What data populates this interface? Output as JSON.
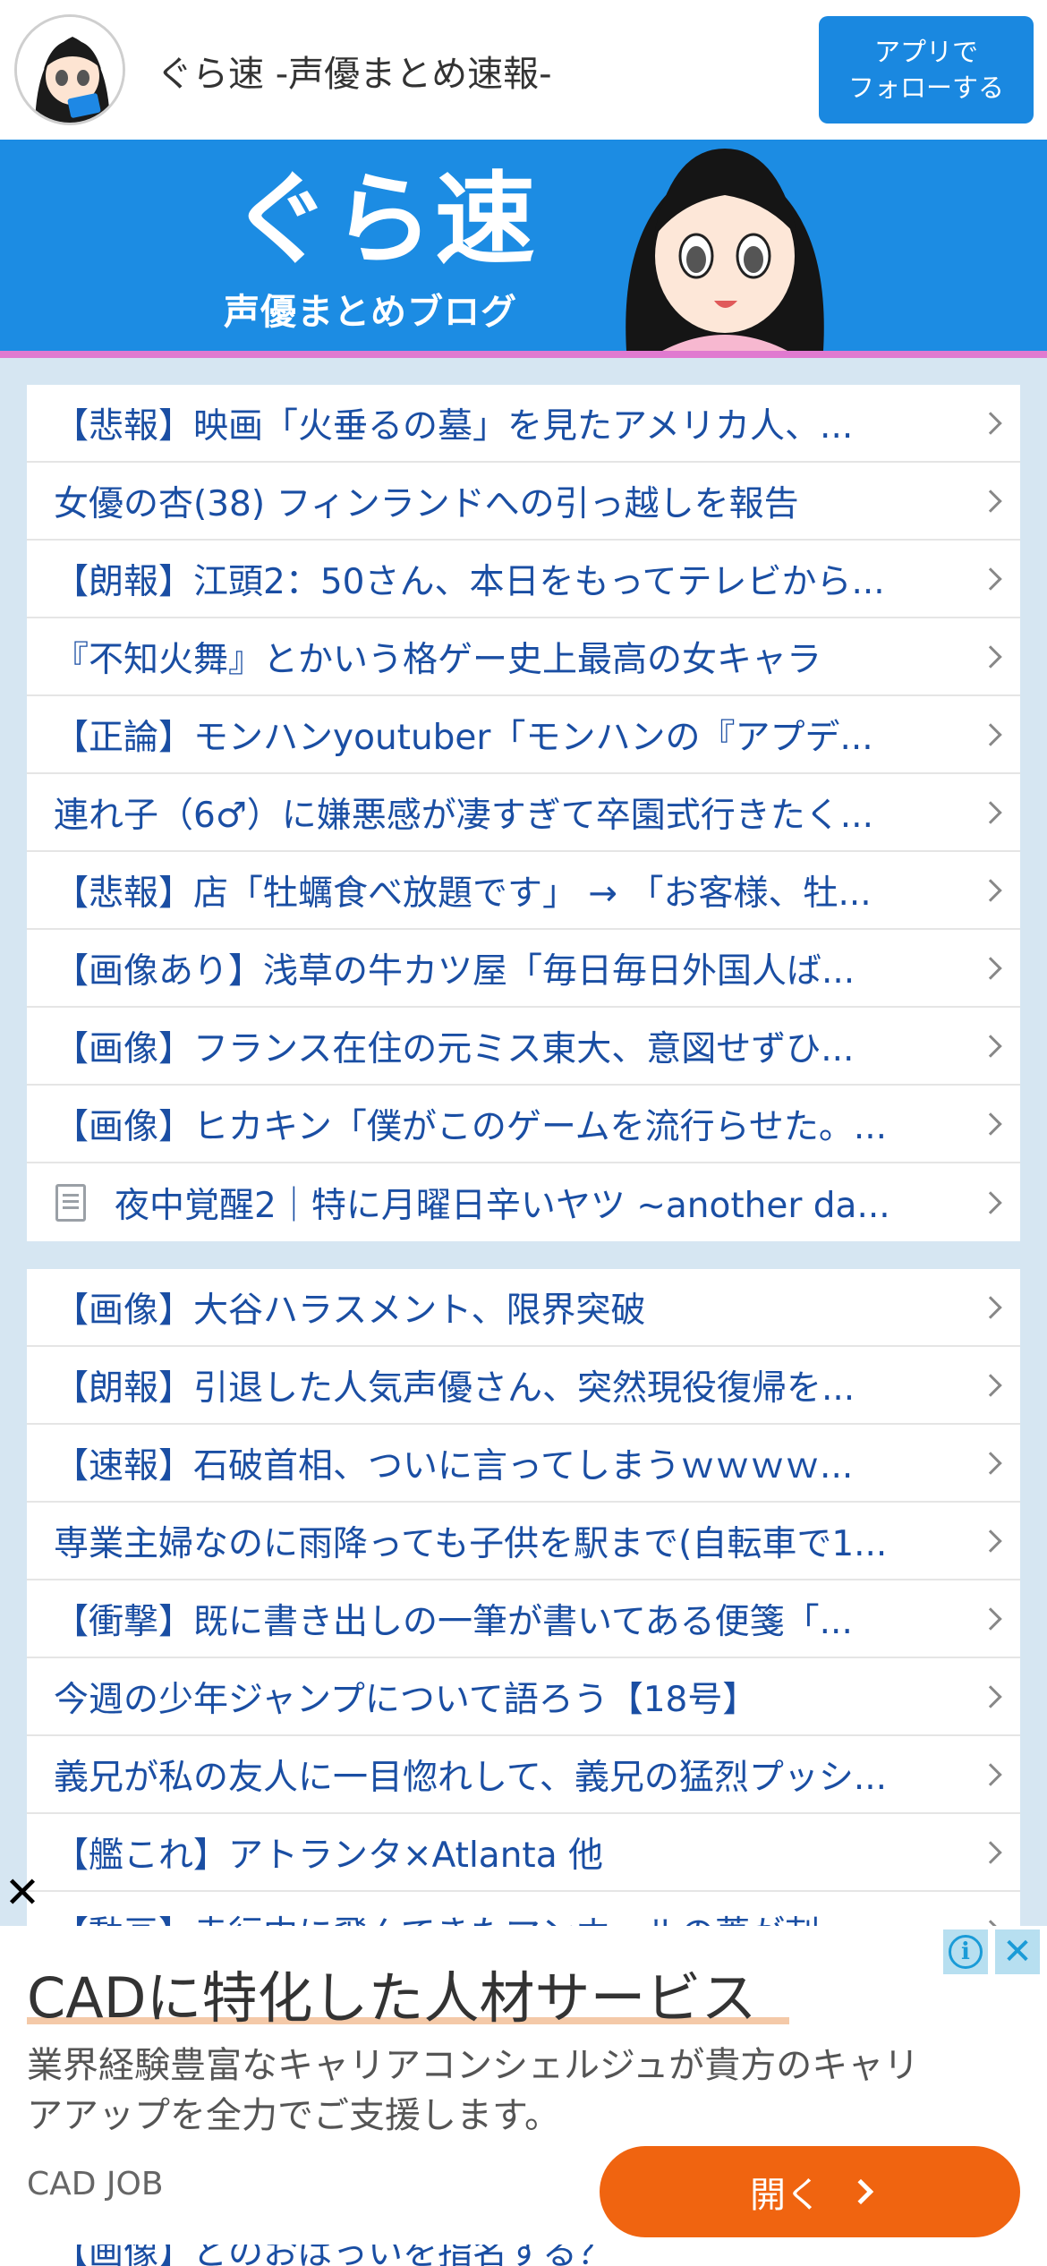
{
  "header": {
    "site_title": "ぐら速 -声優まとめ速報-",
    "follow_button": "アプリで\nフォローする"
  },
  "banner": {
    "logo": "ぐら速",
    "subtitle": "声優まとめブログ"
  },
  "list1": [
    "【悲報】映画「火垂るの墓」を見たアメリカ人、...",
    "女優の杏(38) フィンランドへの引っ越しを報告",
    "【朗報】江頭2：50さん、本日をもってテレビから...",
    "『不知火舞』とかいう格ゲー史上最高の女キャラ",
    "【正論】モンハンyoutuber「モンハンの『アプデ...",
    "連れ子（6♂）に嫌悪感が凄すぎて卒園式行きたく...",
    "【悲報】店「牡蠣食べ放題です」 → 「お客様、牡...",
    "【画像あり】浅草の牛カツ屋「毎日毎日外国人ば...",
    "【画像】フランス在住の元ミス東大、意図せずひ...",
    "【画像】ヒカキン「僕がこのゲームを流行らせた。...",
    "夜中覚醒2｜特に月曜日辛いヤツ ~another da..."
  ],
  "list2": [
    "【画像】大谷ハラスメント、限界突破",
    "【朗報】引退した人気声優さん、突然現役復帰を...",
    "【速報】石破首相、ついに言ってしまうｗｗｗｗ...",
    "専業主婦なのに雨降っても子供を駅まで(自転車で1...",
    "【衝撃】既に書き出しの一筆が書いてある便箋「...",
    "今週の少年ジャンプについて語ろう【18号】",
    "義兄が私の友人に一目惚れして、義兄の猛烈プッシ...",
    "【艦これ】アトランタ×Atlanta 他",
    "【動画】走行中に飛んできたマンホールの蓋が刺..."
  ],
  "ad": {
    "headline": "CADに特化した人材サービス",
    "body": "業界経験豊富なキャリアコンシェルジュが貴方のキャリアアップを全力でご支援します。",
    "brand": "CAD JOB",
    "open_button": "開く",
    "close_mark": "✕"
  },
  "bottom_peek": "【画像】どのおぱっいを指名する？"
}
